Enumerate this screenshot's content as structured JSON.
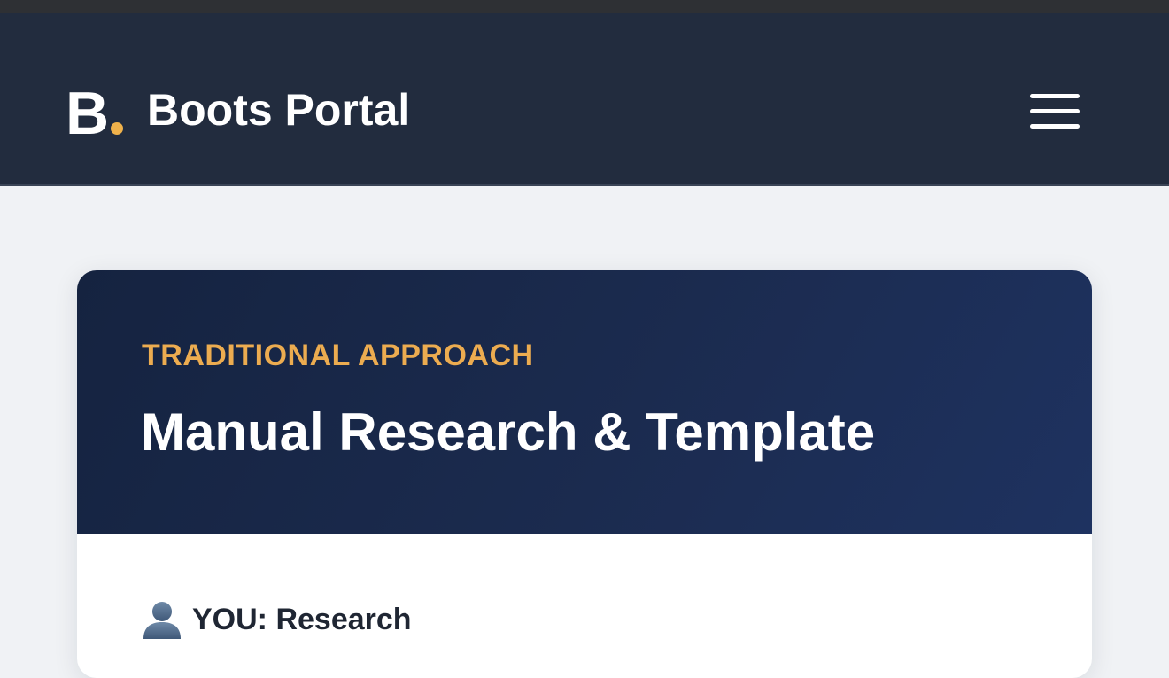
{
  "header": {
    "logo_letter": "B",
    "brand_name": "Boots Portal",
    "menu_icon": "hamburger-menu-icon"
  },
  "card": {
    "eyebrow": "TRADITIONAL APPROACH",
    "title": "Manual Research & Template",
    "section": {
      "icon": "user-silhouette-icon",
      "label": "YOU: Research"
    }
  },
  "colors": {
    "nav_background": "#222c3e",
    "page_background": "#f0f2f5",
    "accent": "#ecac50",
    "hero_background": "#1b2b4f",
    "text_dark": "#1f2633"
  }
}
